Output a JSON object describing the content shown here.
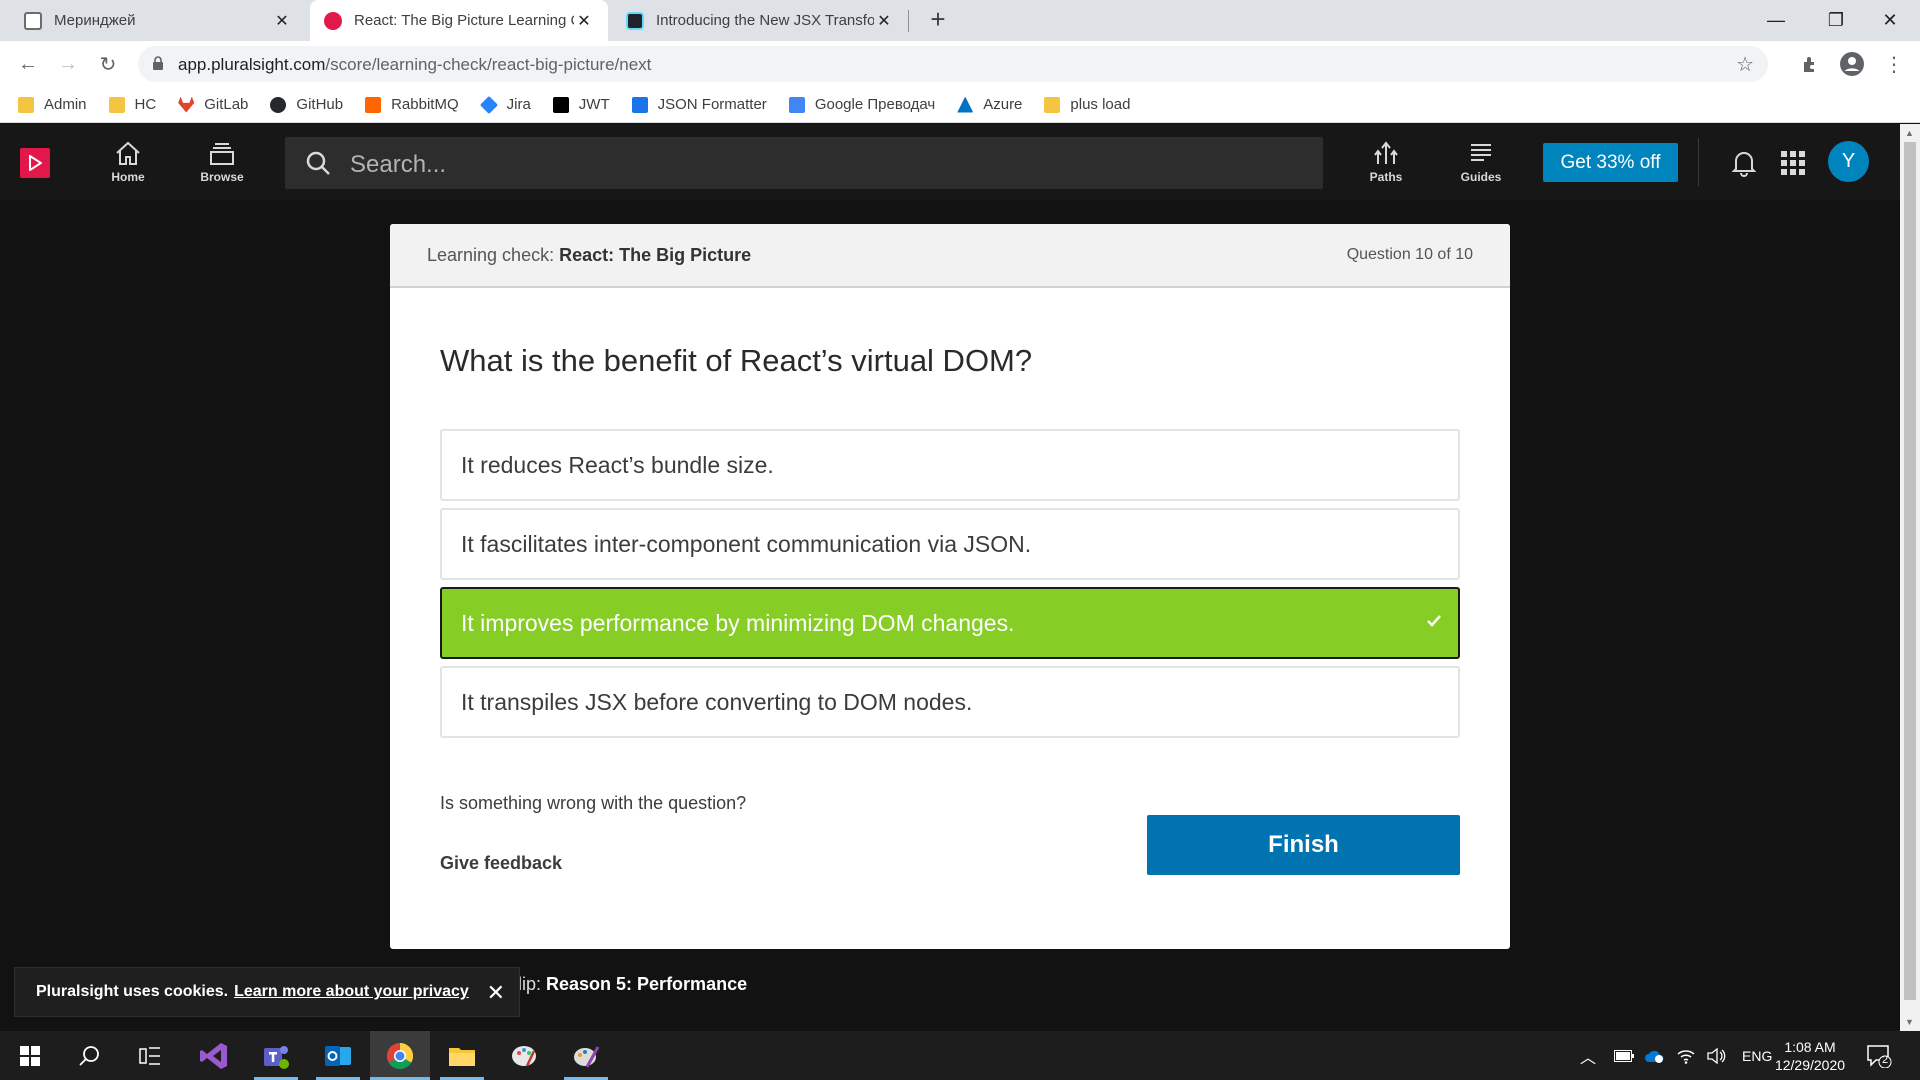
{
  "browser": {
    "tabs": [
      {
        "title": "Мериндж​ей",
        "active": false
      },
      {
        "title": "React: The Big Picture Learning C",
        "active": true
      },
      {
        "title": "Introducing the New JSX Transfor",
        "active": false
      }
    ],
    "url_host": "app.pluralsight.com",
    "url_path": "/score/learning-check/react-big-picture/next",
    "bookmarks": [
      "Admin",
      "HC",
      "GitLab",
      "GitHub",
      "RabbitMQ",
      "Jira",
      "JWT",
      "JSON Formatter",
      "Google Преводач",
      "Azure",
      "plus load"
    ]
  },
  "header": {
    "nav": {
      "home": "Home",
      "browse": "Browse",
      "paths": "Paths",
      "guides": "Guides"
    },
    "search_placeholder": "Search...",
    "promo": "Get 33% off",
    "avatar_initial": "Y"
  },
  "card": {
    "label_prefix": "Learning check: ",
    "course_title": "React: The Big Picture",
    "question_count": "Question 10 of 10",
    "question": "What is the benefit of React’s virtual DOM?",
    "options": [
      "It reduces React’s bundle size.",
      "It fascilitates inter-component communication via JSON.",
      "It improves performance by minimizing DOM changes.",
      "It transpiles JSX before converting to DOM nodes."
    ],
    "correct_index": 2,
    "wrong_prompt": "Is something wrong with the question?",
    "feedback": "Give feedback",
    "finish": "Finish"
  },
  "clip": {
    "prefix": "Clip: ",
    "title": "Reason 5: Performance"
  },
  "cookie": {
    "text": "Pluralsight uses cookies.",
    "link": "Learn more about your privacy"
  },
  "taskbar": {
    "lang": "ENG",
    "time": "1:08 AM",
    "date": "12/29/2020",
    "notifications": "2"
  },
  "colors": {
    "accent_pink": "#e2174a",
    "blue": "#0084bd",
    "correct_green": "#86cd25",
    "finish_blue": "#0073b0"
  }
}
